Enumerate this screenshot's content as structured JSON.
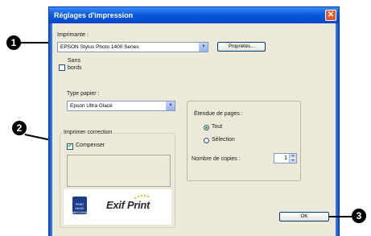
{
  "window": {
    "title": "Réglages d'impression",
    "close_glyph": "✕"
  },
  "printer": {
    "label": "Imprimante :",
    "selected": "EPSON Stylus Photo 1400 Series",
    "properties_button": "Propriétés..."
  },
  "borderless": {
    "label_line1": "Sans",
    "label_line2": "bords",
    "checked": false
  },
  "paper": {
    "label": "Type papier :",
    "selected": "Epson Ultra Glacé"
  },
  "correction": {
    "group_title": "Imprimer correction",
    "compensate_label": "Compenser",
    "compensate_checked": true
  },
  "page_range": {
    "group_title": "Étendue de pages :",
    "options": [
      {
        "label": "Tout",
        "selected": true
      },
      {
        "label": "Sélection",
        "selected": false
      }
    ],
    "copies_label": "Nombre de copies :",
    "copies_value": "1"
  },
  "logos": {
    "pim_text": "PRINT IMAGE MATCHING",
    "exif_text": "Exif Print"
  },
  "ok_button": "OK",
  "callouts": [
    "1",
    "2",
    "3"
  ]
}
